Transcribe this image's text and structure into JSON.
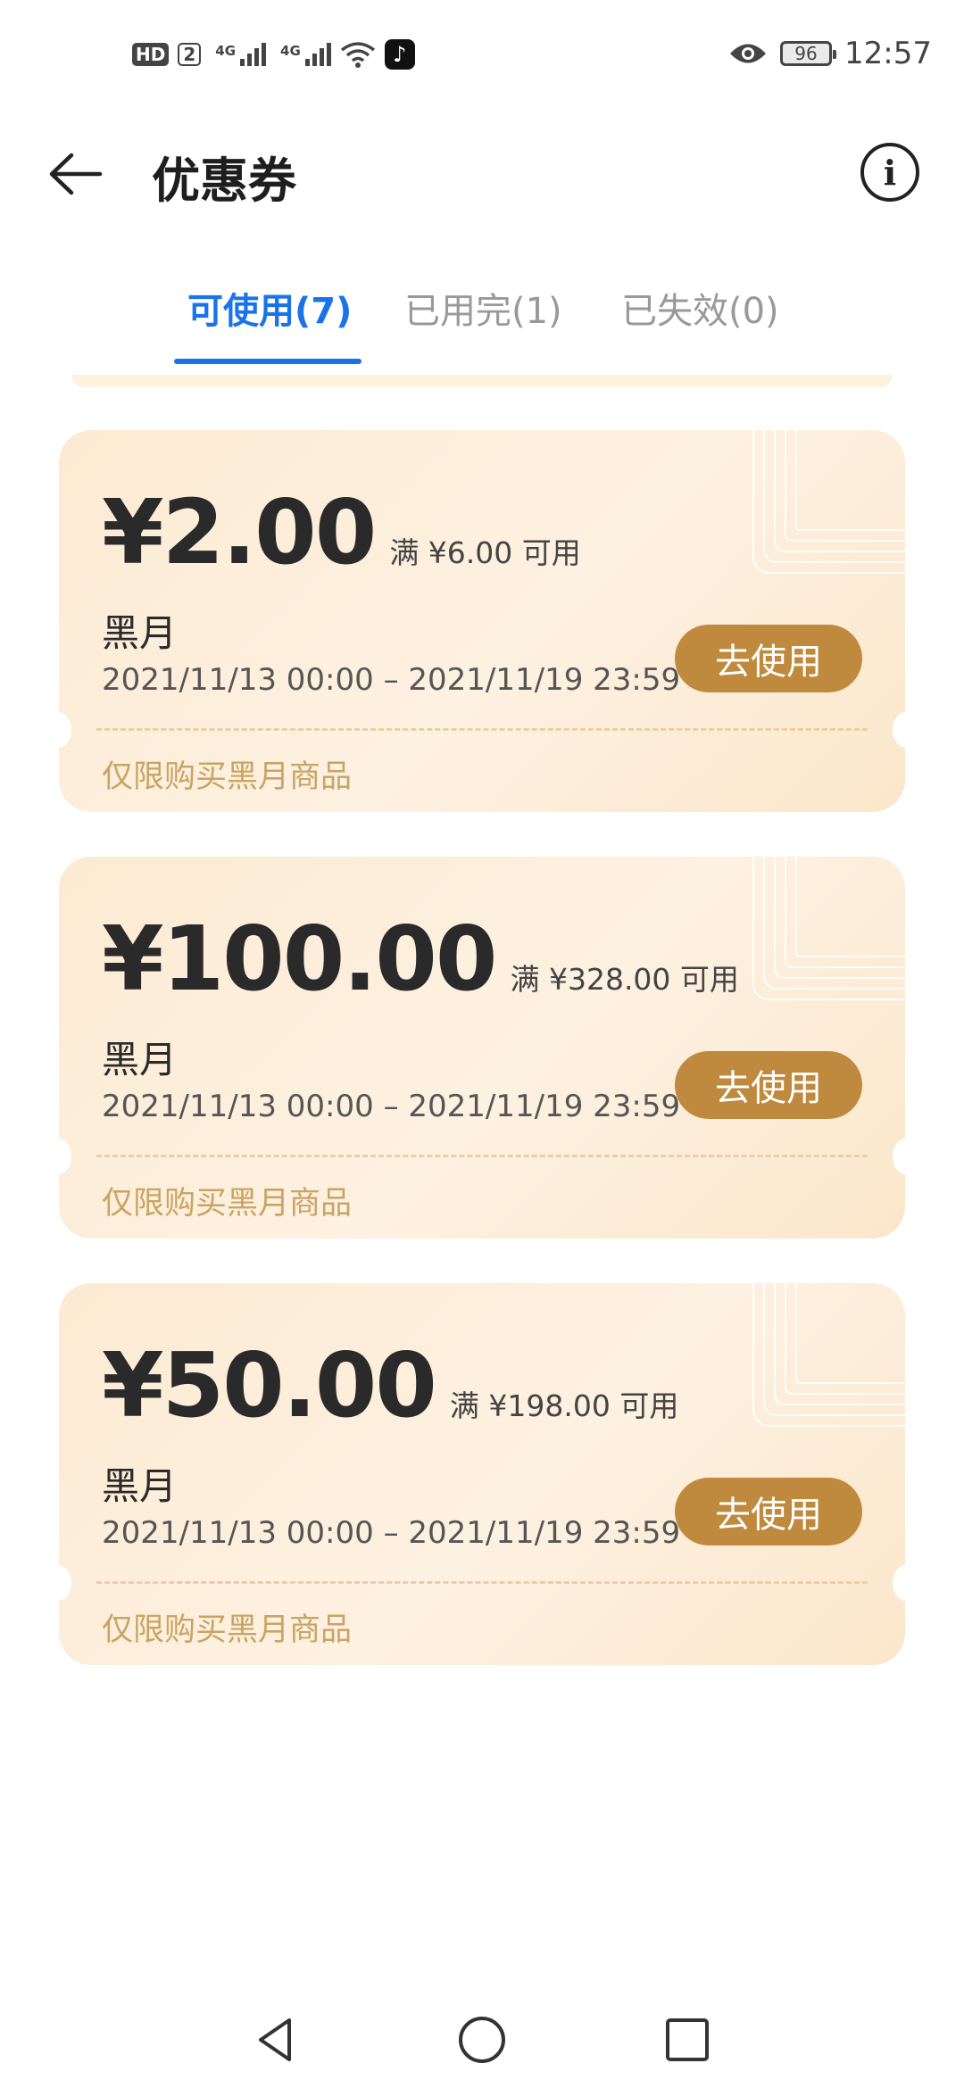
{
  "status_bar": {
    "hd": "HD",
    "sim": "2",
    "network1": "4G",
    "network2": "4G",
    "battery": "96",
    "time": "12:57"
  },
  "header": {
    "title": "优惠券"
  },
  "tabs": [
    {
      "label": "可使用(7)",
      "active": true
    },
    {
      "label": "已用完(1)",
      "active": false
    },
    {
      "label": "已失效(0)",
      "active": false
    }
  ],
  "coupons": [
    {
      "amount": "¥2.00",
      "condition": "满 ¥6.00 可用",
      "shop": "黑月",
      "period": "2021/11/13 00:00 – 2021/11/19 23:59",
      "action": "去使用",
      "scope": "仅限购买黑月商品"
    },
    {
      "amount": "¥100.00",
      "condition": "满 ¥328.00 可用",
      "shop": "黑月",
      "period": "2021/11/13 00:00 – 2021/11/19 23:59",
      "action": "去使用",
      "scope": "仅限购买黑月商品"
    },
    {
      "amount": "¥50.00",
      "condition": "满 ¥198.00 可用",
      "shop": "黑月",
      "period": "2021/11/13 00:00 – 2021/11/19 23:59",
      "action": "去使用",
      "scope": "仅限购买黑月商品"
    }
  ],
  "icons": {
    "back": "arrow-left-icon",
    "info": "info-icon",
    "nav_back": "triangle-back-icon",
    "nav_home": "circle-home-icon",
    "nav_recent": "square-recent-icon"
  },
  "colors": {
    "accent": "#1a73e8",
    "coupon_bg": "#fcebd3",
    "use_button": "#c08a3e",
    "scope_text": "#c9a464"
  }
}
